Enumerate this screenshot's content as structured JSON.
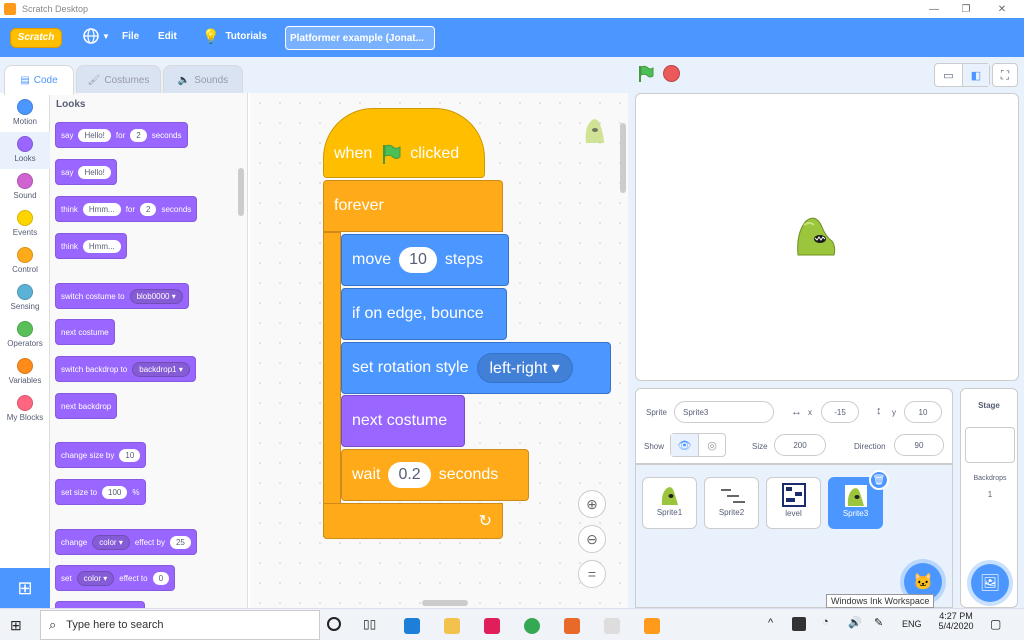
{
  "window": {
    "title": "Scratch Desktop",
    "controls": [
      "—",
      "❐",
      "✕"
    ]
  },
  "menubar": {
    "logo": "Scratch",
    "file": "File",
    "edit": "Edit",
    "tutorials": "Tutorials",
    "project_name": "Platformer example (Jonat..."
  },
  "tabs": {
    "code": "Code",
    "costumes": "Costumes",
    "sounds": "Sounds"
  },
  "categories": [
    {
      "label": "Motion",
      "color": "#4c97ff"
    },
    {
      "label": "Looks",
      "color": "#9966ff"
    },
    {
      "label": "Sound",
      "color": "#cf63cf"
    },
    {
      "label": "Events",
      "color": "#ffd500"
    },
    {
      "label": "Control",
      "color": "#ffab19"
    },
    {
      "label": "Sensing",
      "color": "#5cb1d6"
    },
    {
      "label": "Operators",
      "color": "#59c059"
    },
    {
      "label": "Variables",
      "color": "#ff8c1a"
    },
    {
      "label": "My Blocks",
      "color": "#ff6680"
    }
  ],
  "palette": {
    "heading": "Looks",
    "say_for": {
      "say": "say",
      "msg": "Hello!",
      "for": "for",
      "secs": "2",
      "seconds": "seconds"
    },
    "say": {
      "say": "say",
      "msg": "Hello!"
    },
    "think_for": {
      "think": "think",
      "msg": "Hmm...",
      "for": "for",
      "secs": "2",
      "seconds": "seconds"
    },
    "think": {
      "think": "think",
      "msg": "Hmm..."
    },
    "switch_costume": {
      "label": "switch costume to",
      "value": "blob0000"
    },
    "next_costume": "next costume",
    "switch_backdrop": {
      "label": "switch backdrop to",
      "value": "backdrop1"
    },
    "next_backdrop": "next backdrop",
    "change_size": {
      "label": "change size by",
      "value": "10"
    },
    "set_size": {
      "label": "set size to",
      "value": "100",
      "unit": "%"
    },
    "change_effect": {
      "label": "change",
      "effect": "color",
      "by": "effect by",
      "value": "25"
    },
    "set_effect": {
      "label": "set",
      "effect": "color",
      "to": "effect to",
      "value": "0"
    }
  },
  "script": {
    "when": "when",
    "clicked": "clicked",
    "forever": "forever",
    "move": "move",
    "steps_value": "10",
    "steps": "steps",
    "bounce": "if on edge, bounce",
    "rotation": "set rotation style",
    "rotation_value": "left-right",
    "next_costume": "next costume",
    "wait": "wait",
    "wait_value": "0.2",
    "seconds": "seconds"
  },
  "sprite_info": {
    "sprite_label": "Sprite",
    "sprite_name": "Sprite3",
    "x_label": "x",
    "x_value": "-15",
    "y_label": "y",
    "y_value": "10",
    "show_label": "Show",
    "size_label": "Size",
    "size_value": "200",
    "direction_label": "Direction",
    "direction_value": "90"
  },
  "sprites": [
    {
      "name": "Sprite1",
      "selected": false
    },
    {
      "name": "Sprite2",
      "selected": false
    },
    {
      "name": "level",
      "selected": false
    },
    {
      "name": "Sprite3",
      "selected": true
    }
  ],
  "stage_panel": {
    "title": "Stage",
    "backdrops_label": "Backdrops",
    "backdrops_count": "1"
  },
  "tooltip": "Windows Ink Workspace",
  "taskbar": {
    "search_placeholder": "Type here to search",
    "lang": "ENG",
    "time": "4:27 PM",
    "date": "5/4/2020"
  }
}
